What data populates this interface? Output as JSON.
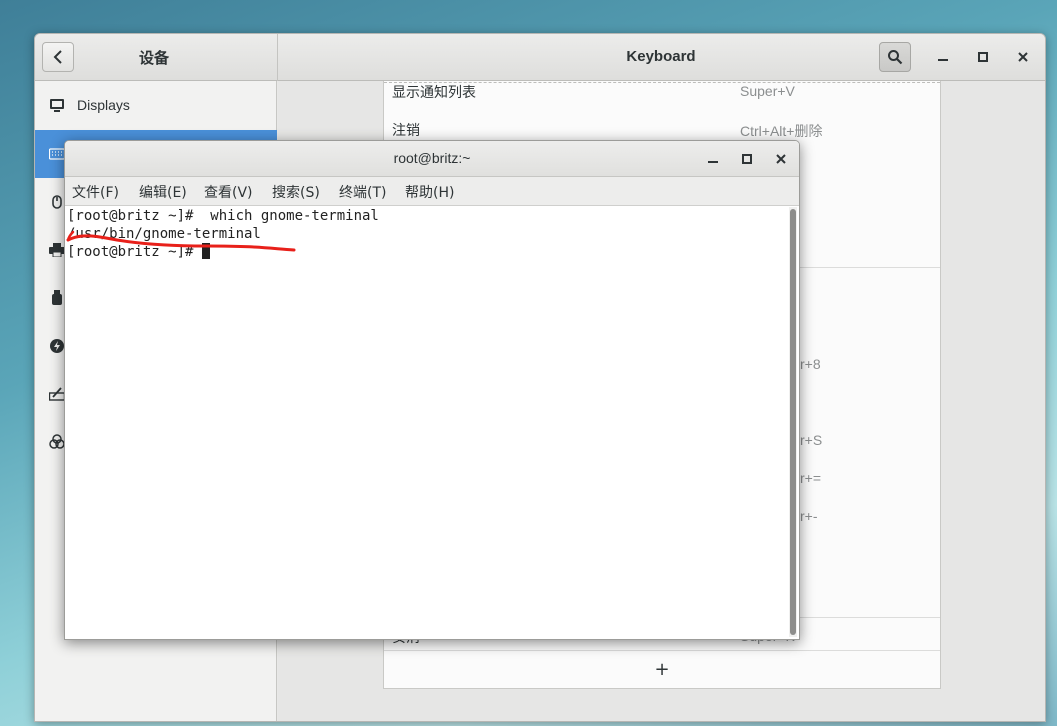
{
  "settings": {
    "sidebar_title": "设备",
    "title": "Keyboard",
    "sidebar": {
      "items": [
        {
          "label": "Displays",
          "icon": "display-icon",
          "selected": false
        },
        {
          "label": "",
          "icon": "keyboard-icon",
          "selected": true
        },
        {
          "label": "",
          "icon": "mouse-icon",
          "selected": false
        },
        {
          "label": "",
          "icon": "printer-icon",
          "selected": false
        },
        {
          "label": "",
          "icon": "usb-drive-icon",
          "selected": false
        },
        {
          "label": "",
          "icon": "power-icon",
          "selected": false
        },
        {
          "label": "",
          "icon": "tablet-icon",
          "selected": false
        },
        {
          "label": "",
          "icon": "color-icon",
          "selected": false
        }
      ]
    },
    "shortcuts": {
      "row1": {
        "action": "显示通知列表",
        "accel": "Super+V"
      },
      "row2": {
        "action": "注销",
        "accel": "Ctrl+Alt+删除"
      },
      "partial1": "r+8",
      "partial2": "r+S",
      "partial3": "r+=",
      "partial4": "r+-",
      "last": {
        "action": "安消",
        "accel": "Super+K"
      }
    },
    "add_label": "+"
  },
  "terminal": {
    "title": "root@britz:~",
    "menu": [
      "文件(F)",
      "编辑(E)",
      "查看(V)",
      "搜索(S)",
      "终端(T)",
      "帮助(H)"
    ],
    "lines": [
      "[root@britz ~]#  which gnome-terminal",
      "/usr/bin/gnome-terminal",
      "[root@britz ~]# "
    ]
  },
  "colors": {
    "accent": "#4a90d9",
    "annotation": "#e8201a"
  }
}
